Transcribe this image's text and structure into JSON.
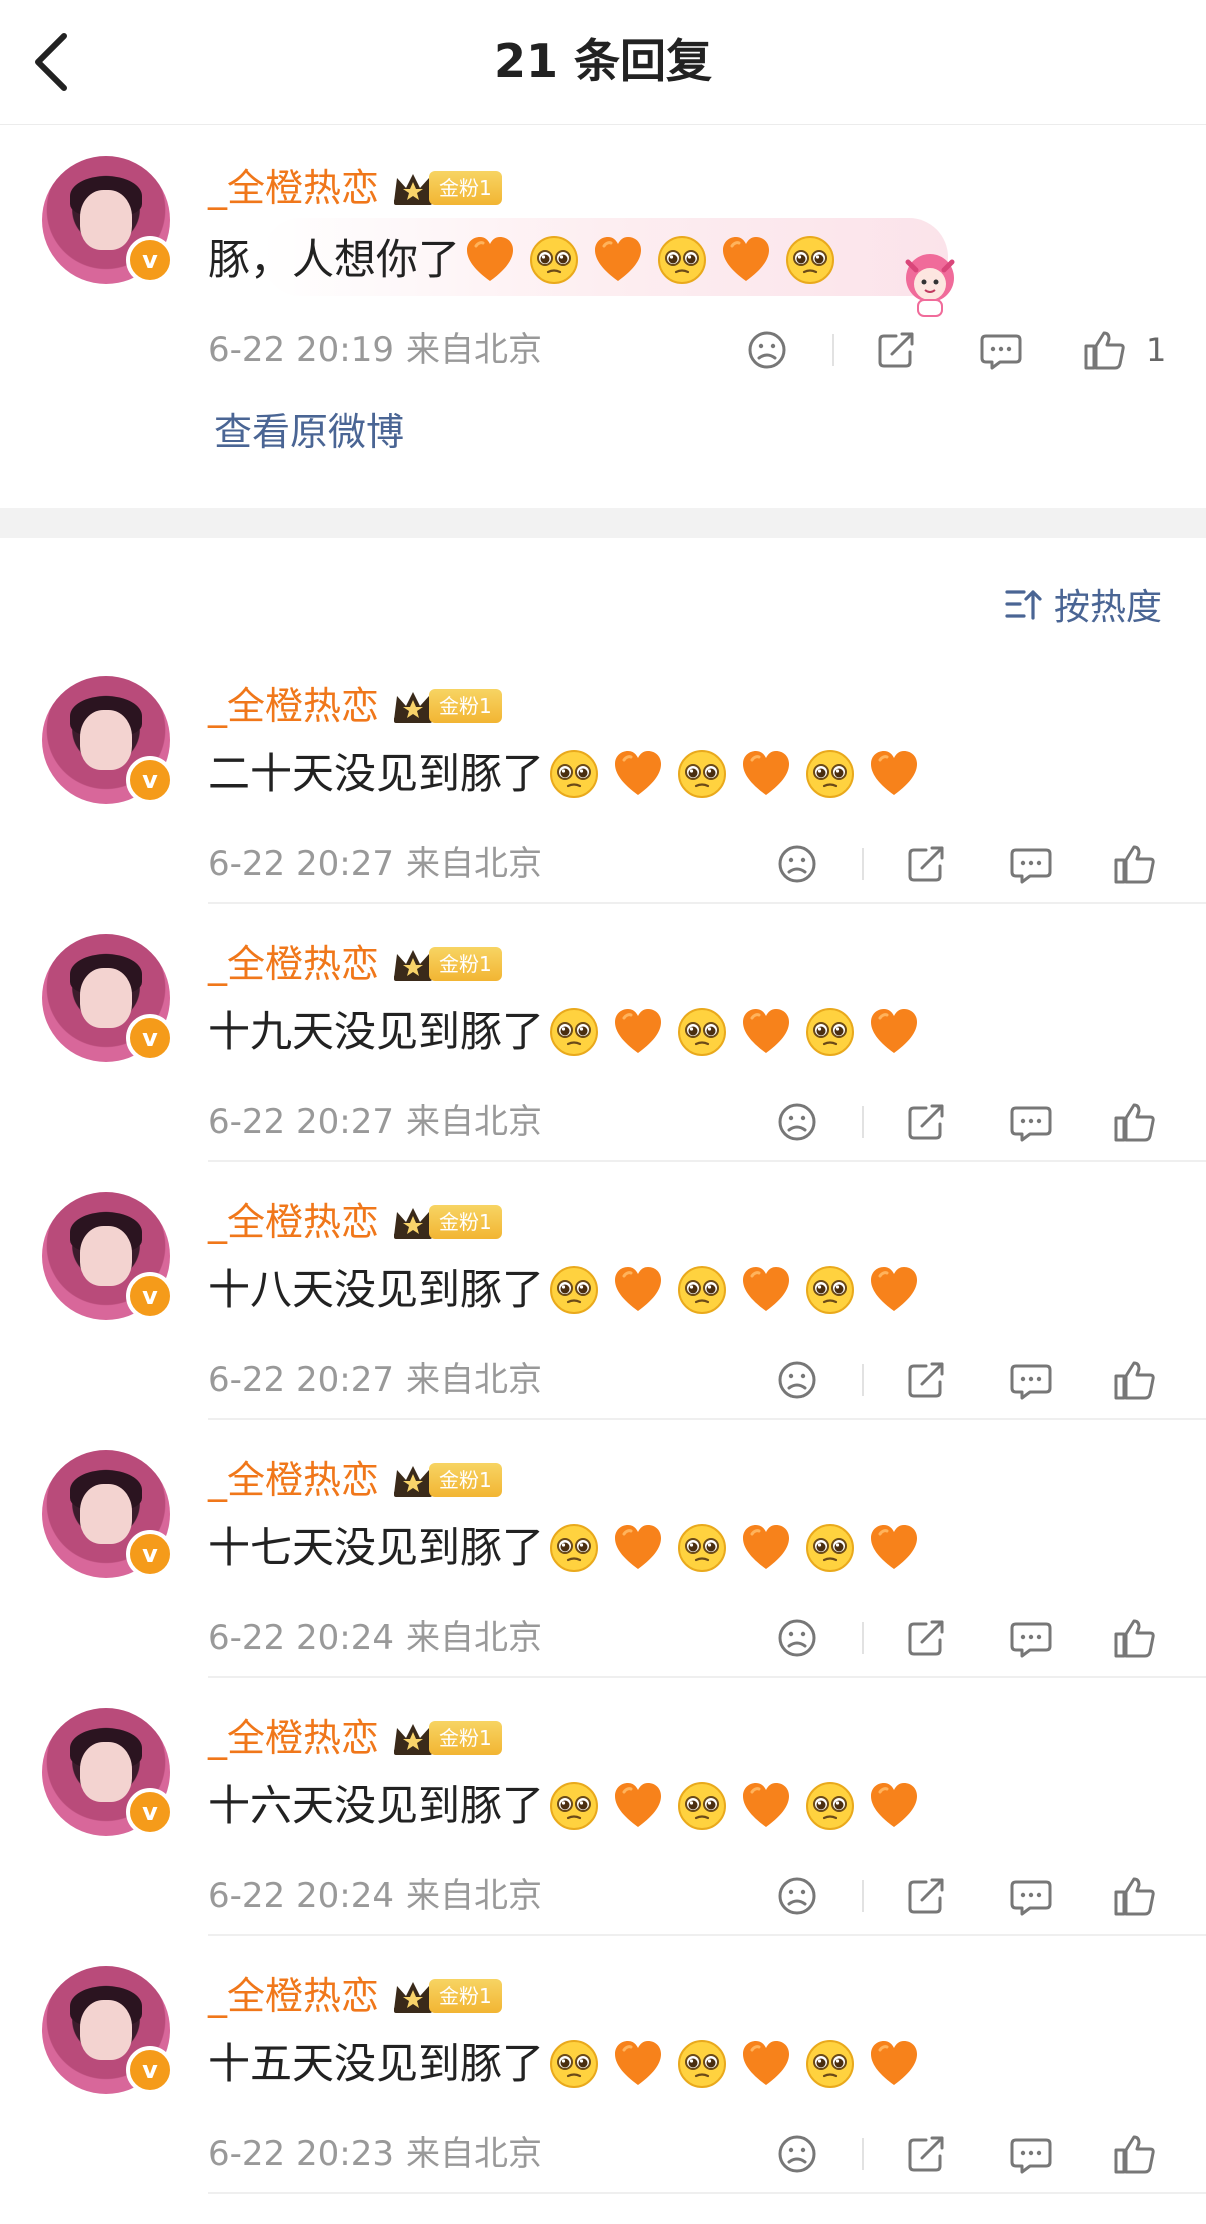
{
  "header": {
    "title": "21 条回复"
  },
  "colors": {
    "accent_orange": "#f0771a",
    "link_blue": "#4a6594",
    "meta_gray": "#999999",
    "badge_gold": "#f2b533"
  },
  "top_comment": {
    "username": "_全橙热恋",
    "fan_badge": "金粉1",
    "text": "豚，人想你了",
    "emojis": [
      "orange-heart",
      "pleading-face",
      "orange-heart",
      "pleading-face",
      "orange-heart",
      "pleading-face"
    ],
    "time": "6-22 20:19",
    "location": "来自北京",
    "like_count": "1",
    "view_original": "查看原微博"
  },
  "sort": {
    "label": "按热度"
  },
  "replies": [
    {
      "username": "_全橙热恋",
      "fan_badge": "金粉1",
      "text": "二十天没见到豚了",
      "time": "6-22 20:27",
      "location": "来自北京"
    },
    {
      "username": "_全橙热恋",
      "fan_badge": "金粉1",
      "text": "十九天没见到豚了",
      "time": "6-22 20:27",
      "location": "来自北京"
    },
    {
      "username": "_全橙热恋",
      "fan_badge": "金粉1",
      "text": "十八天没见到豚了",
      "time": "6-22 20:27",
      "location": "来自北京"
    },
    {
      "username": "_全橙热恋",
      "fan_badge": "金粉1",
      "text": "十七天没见到豚了",
      "time": "6-22 20:24",
      "location": "来自北京"
    },
    {
      "username": "_全橙热恋",
      "fan_badge": "金粉1",
      "text": "十六天没见到豚了",
      "time": "6-22 20:24",
      "location": "来自北京"
    },
    {
      "username": "_全橙热恋",
      "fan_badge": "金粉1",
      "text": "十五天没见到豚了",
      "time": "6-22 20:23",
      "location": "来自北京"
    }
  ],
  "reply_emojis": [
    "pleading-face",
    "orange-heart",
    "pleading-face",
    "orange-heart",
    "pleading-face",
    "orange-heart"
  ]
}
